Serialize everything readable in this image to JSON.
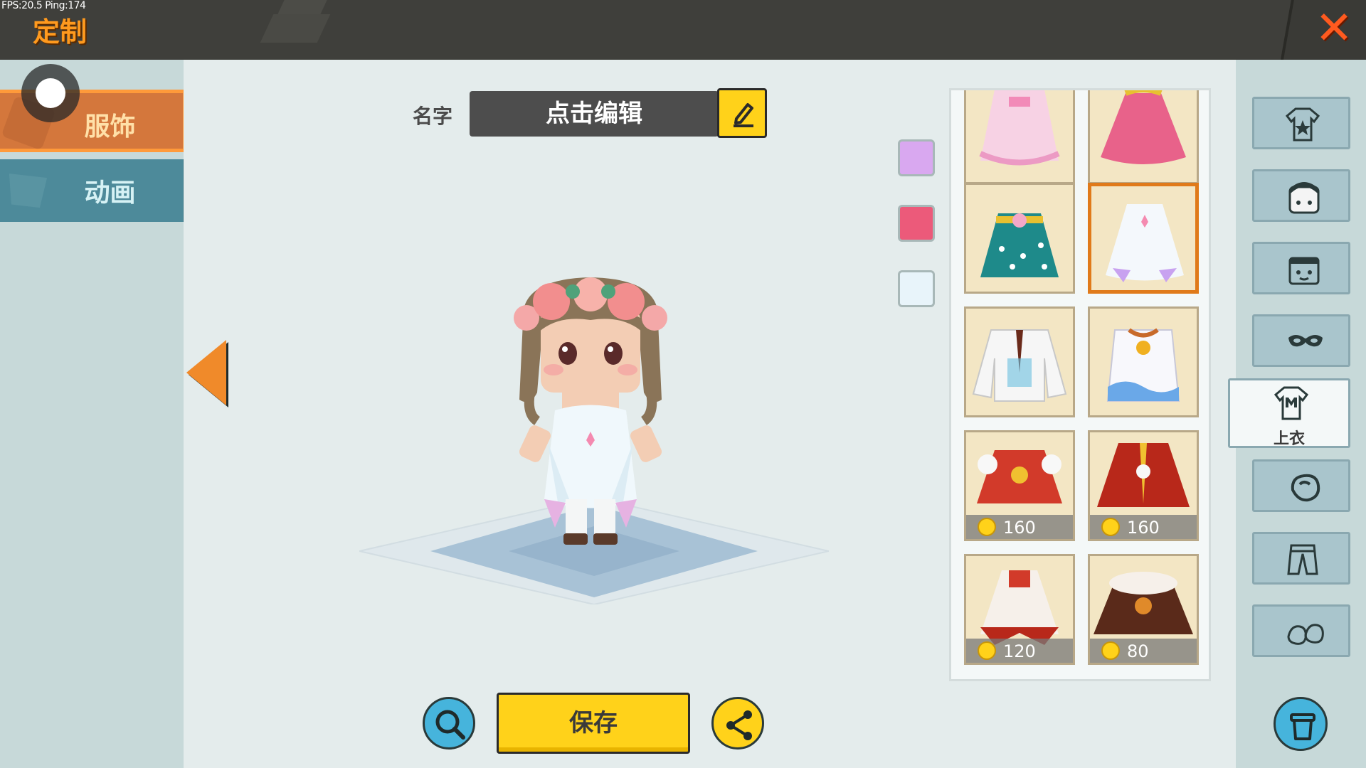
{
  "hud": {
    "fps": "FPS:20.5 Ping:174"
  },
  "header": {
    "title": "定制",
    "close_icon": "close-icon"
  },
  "left_tabs": [
    {
      "label": "服饰",
      "active": true
    },
    {
      "label": "动画",
      "active": false
    }
  ],
  "name_field": {
    "label": "名字",
    "value": "点击编辑"
  },
  "color_swatches": [
    "#d9a8f0",
    "#ec5a7a",
    "#e8f4fa"
  ],
  "items": [
    {
      "name": "pink-lace-dress",
      "price": null,
      "selected": false
    },
    {
      "name": "pink-petal-skirt",
      "price": null,
      "selected": false
    },
    {
      "name": "teal-polka-dress",
      "price": null,
      "selected": false
    },
    {
      "name": "white-petal-dress",
      "price": null,
      "selected": true
    },
    {
      "name": "white-suit-jacket",
      "price": null,
      "selected": false
    },
    {
      "name": "white-wave-vest",
      "price": null,
      "selected": false
    },
    {
      "name": "red-festival-top",
      "price": "160",
      "selected": false
    },
    {
      "name": "red-robe",
      "price": "160",
      "selected": false
    },
    {
      "name": "red-white-dress",
      "price": "120",
      "selected": false
    },
    {
      "name": "brown-fur-cape",
      "price": "80",
      "selected": false
    }
  ],
  "categories": [
    {
      "icon": "outfit-icon"
    },
    {
      "icon": "hair-icon"
    },
    {
      "icon": "face-icon"
    },
    {
      "icon": "mask-icon"
    },
    {
      "icon": "top-icon",
      "label": "上衣",
      "active": true
    },
    {
      "icon": "glove-icon"
    },
    {
      "icon": "pants-icon"
    },
    {
      "icon": "shoes-icon"
    }
  ],
  "bottom": {
    "save_label": "保存",
    "zoom_icon": "zoom-icon",
    "share_icon": "share-icon",
    "trash_icon": "trash-icon"
  },
  "colors": {
    "accent_orange": "#f08a2a",
    "button_yellow": "#ffd21a",
    "button_blue": "#46b4dc",
    "sidebar": "#c7d9d9"
  }
}
